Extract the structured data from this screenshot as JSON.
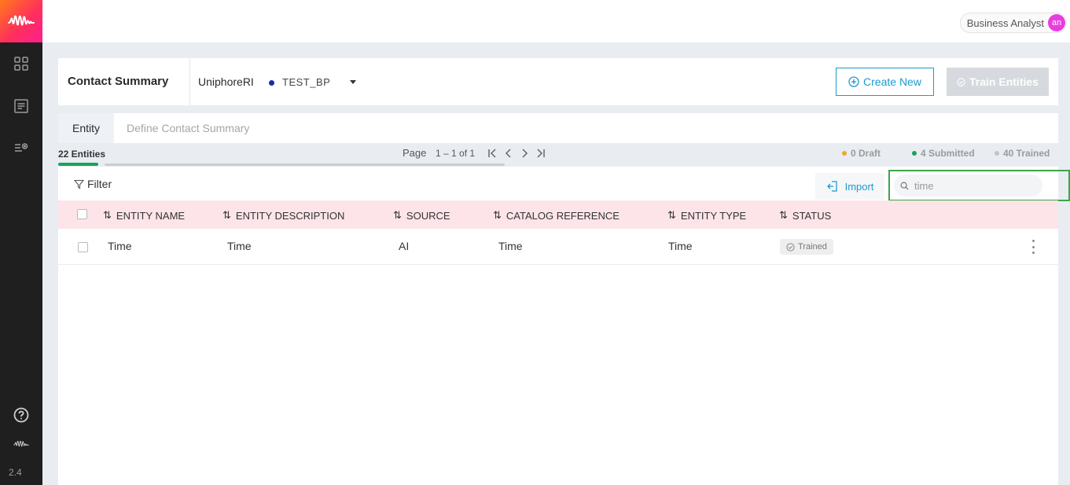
{
  "header": {
    "user_role": "Business Analyst",
    "avatar_initials": "an"
  },
  "sidebar": {
    "version": "2.4",
    "icons": [
      "dashboard-icon",
      "document-icon",
      "settings-list-icon",
      "help-icon",
      "brand-logo-icon"
    ]
  },
  "page": {
    "title": "Contact Summary",
    "app_name": "UniphoreRI",
    "environment": "TEST_BP",
    "create_label": "Create New",
    "train_label": "Train Entities"
  },
  "tabs": [
    {
      "label": "Entity",
      "active": true
    },
    {
      "label": "Define Contact Summary",
      "active": false
    }
  ],
  "stats": {
    "entity_count": "22 Entities",
    "page_label": "Page",
    "page_range": "1 – 1 of 1",
    "draft": "0 Draft",
    "submitted": "4 Submitted",
    "trained": "40 Trained"
  },
  "toolbar": {
    "filter_label": "Filter",
    "import_label": "Import",
    "search_value": "time"
  },
  "table": {
    "columns": [
      "ENTITY NAME",
      "ENTITY DESCRIPTION",
      "SOURCE",
      "CATALOG REFERENCE",
      "ENTITY TYPE",
      "STATUS"
    ],
    "rows": [
      {
        "name": "Time",
        "description": "Time",
        "source": "AI",
        "catalog": "Time",
        "type": "Time",
        "status": "Trained"
      }
    ]
  },
  "colors": {
    "accent": "#1b9bd1",
    "draft": "#f5a623",
    "submitted": "#17a35c",
    "trained": "#c4c4c4",
    "header_row": "#fde4e9",
    "focus_outline": "#3aa64a"
  }
}
